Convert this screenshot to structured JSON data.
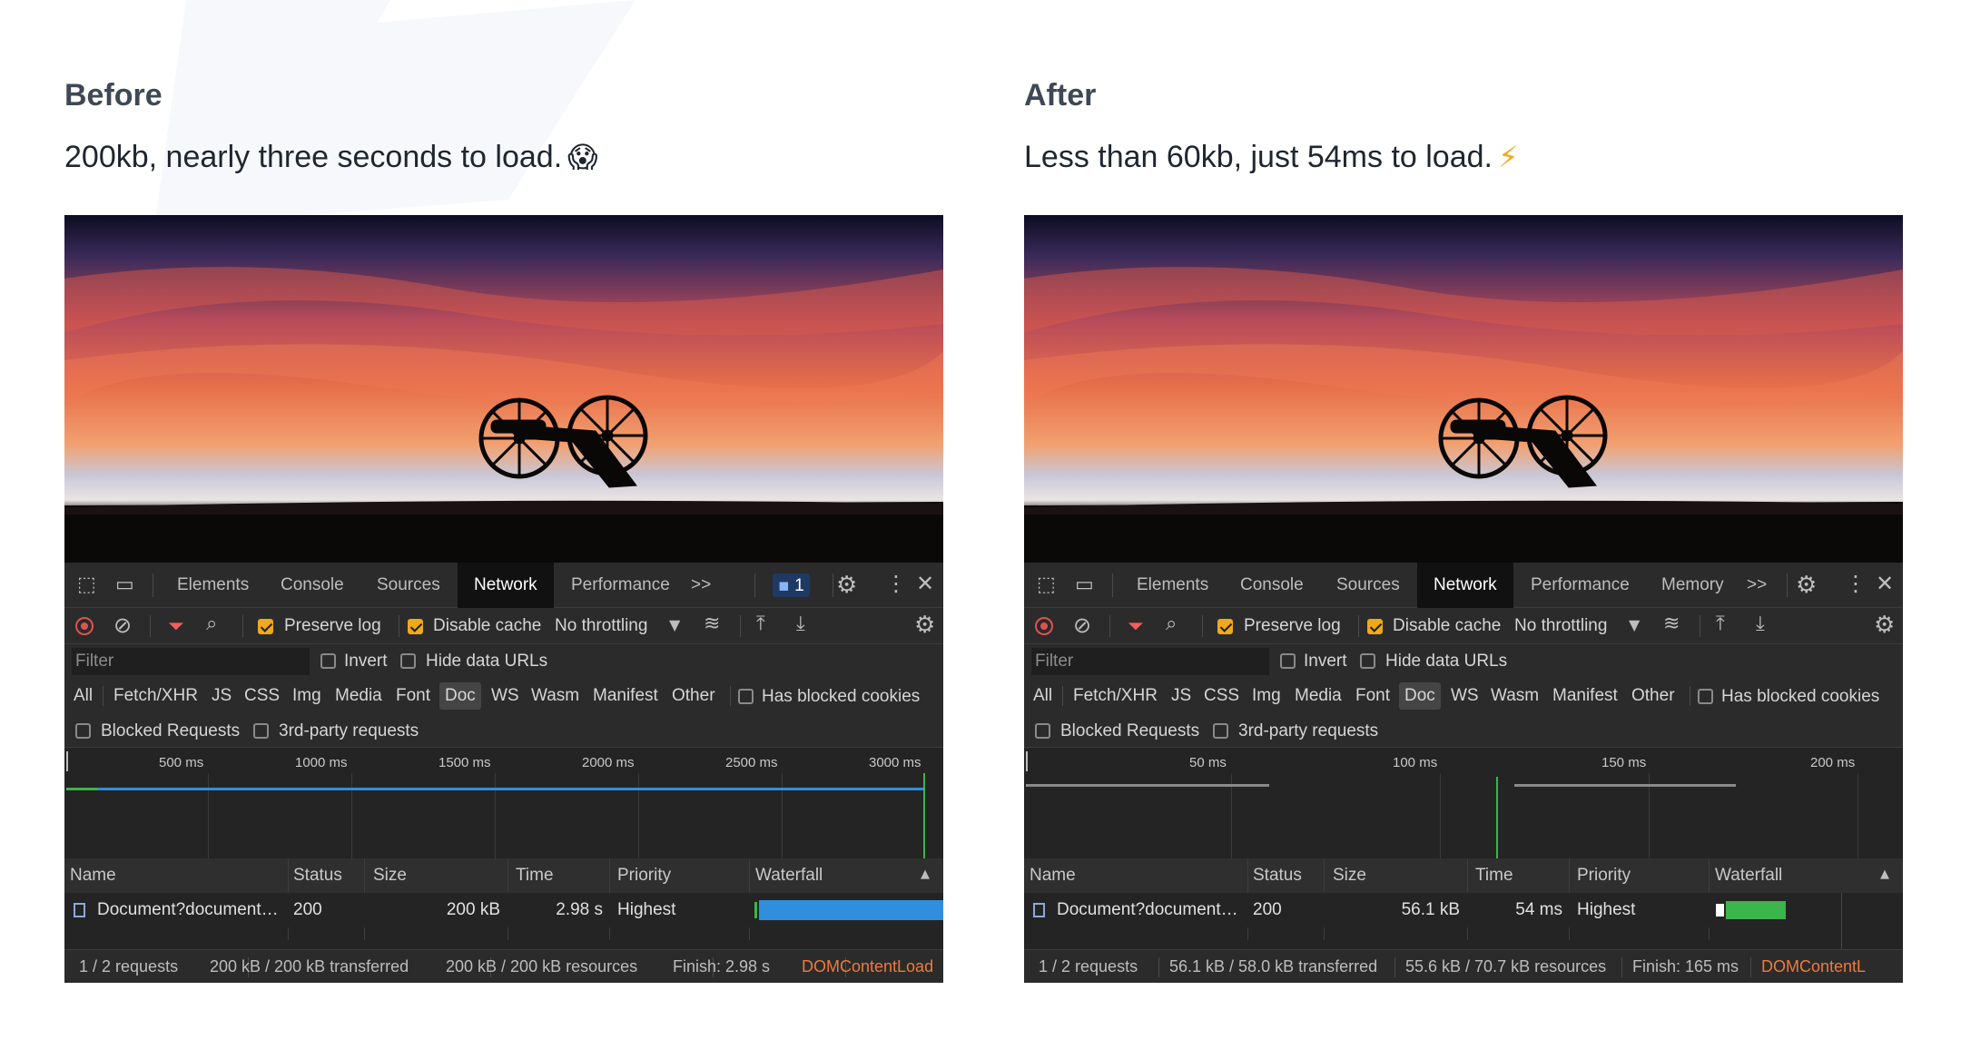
{
  "before": {
    "heading": "Before",
    "caption": "200kb, nearly three seconds to load.",
    "caption_emoji": "😱",
    "devtools": {
      "tabs": [
        "Elements",
        "Console",
        "Sources",
        "Network",
        "Performance"
      ],
      "active_tab": "Network",
      "more_tabs": ">>",
      "issues_badge": "1",
      "preserve_log": "Preserve log",
      "disable_cache": "Disable cache",
      "throttling": "No throttling",
      "filter_placeholder": "Filter",
      "invert": "Invert",
      "hide_data_urls": "Hide data URLs",
      "types": [
        "All",
        "Fetch/XHR",
        "JS",
        "CSS",
        "Img",
        "Media",
        "Font",
        "Doc",
        "WS",
        "Wasm",
        "Manifest",
        "Other"
      ],
      "selected_type": "Doc",
      "has_blocked_cookies": "Has blocked cookies",
      "blocked_requests": "Blocked Requests",
      "third_party": "3rd-party requests",
      "ticks": [
        "500 ms",
        "1000 ms",
        "1500 ms",
        "2000 ms",
        "2500 ms",
        "3000 ms"
      ],
      "columns": [
        "Name",
        "Status",
        "Size",
        "Time",
        "Priority",
        "Waterfall"
      ],
      "row": {
        "name": "Document?document…",
        "status": "200",
        "size": "200 kB",
        "time": "2.98 s",
        "priority": "Highest"
      },
      "status_bar": [
        "1 / 2 requests",
        "200 kB / 200 kB transferred",
        "200 kB / 200 kB resources",
        "Finish: 2.98 s",
        "DOMContentLoad"
      ]
    }
  },
  "after": {
    "heading": "After",
    "caption": "Less than 60kb, just 54ms to load.",
    "caption_emoji": "⚡",
    "devtools": {
      "tabs": [
        "Elements",
        "Console",
        "Sources",
        "Network",
        "Performance",
        "Memory"
      ],
      "active_tab": "Network",
      "more_tabs": ">>",
      "preserve_log": "Preserve log",
      "disable_cache": "Disable cache",
      "throttling": "No throttling",
      "filter_placeholder": "Filter",
      "invert": "Invert",
      "hide_data_urls": "Hide data URLs",
      "types": [
        "All",
        "Fetch/XHR",
        "JS",
        "CSS",
        "Img",
        "Media",
        "Font",
        "Doc",
        "WS",
        "Wasm",
        "Manifest",
        "Other"
      ],
      "selected_type": "Doc",
      "has_blocked_cookies": "Has blocked cookies",
      "blocked_requests": "Blocked Requests",
      "third_party": "3rd-party requests",
      "ticks": [
        "50 ms",
        "100 ms",
        "150 ms",
        "200 ms"
      ],
      "columns": [
        "Name",
        "Status",
        "Size",
        "Time",
        "Priority",
        "Waterfall"
      ],
      "row": {
        "name": "Document?document…",
        "status": "200",
        "size": "56.1 kB",
        "time": "54 ms",
        "priority": "Highest"
      },
      "status_bar": [
        "1 / 2 requests",
        "56.1 kB / 58.0 kB transferred",
        "55.6 kB / 70.7 kB resources",
        "Finish: 165 ms",
        "DOMContentL"
      ]
    }
  },
  "colors": {
    "waterfall_before": "#2f8fdc",
    "waterfall_after": "#3cb54a",
    "checkbox_on": "#f0a81c",
    "domcontent": "#f07a3a"
  }
}
